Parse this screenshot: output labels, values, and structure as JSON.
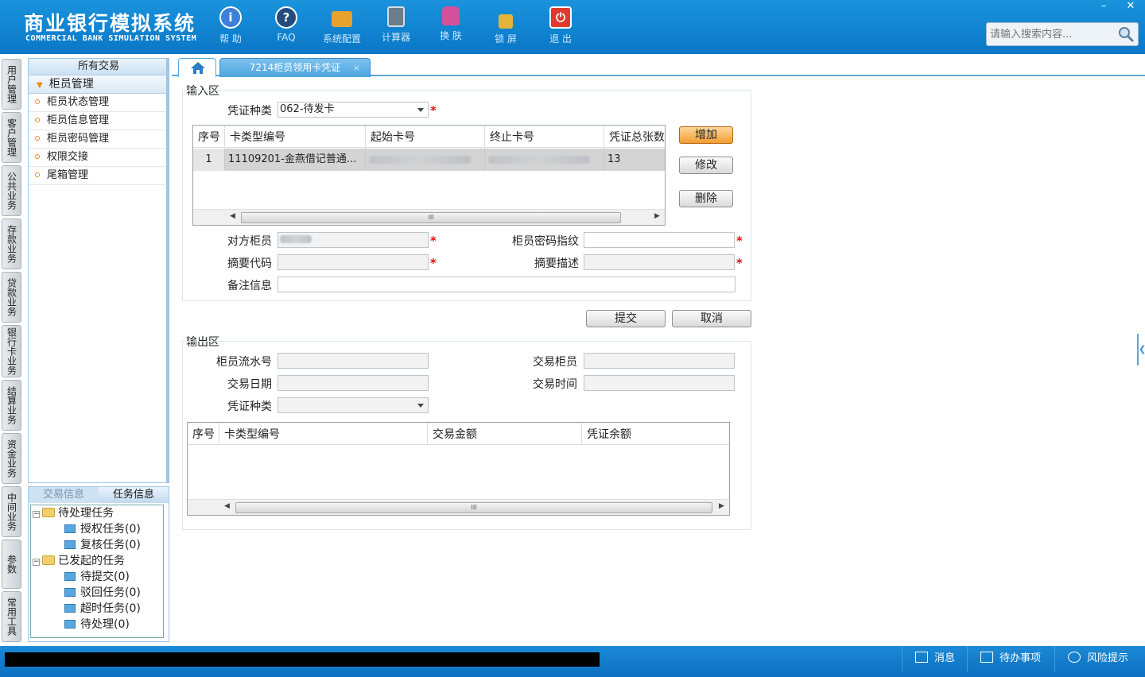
{
  "header": {
    "title_cn": "商业银行模拟系统",
    "title_en": "COMMERCIAL BANK SIMULATION SYSTEM",
    "tools": [
      {
        "label": "帮 助",
        "icon": "help-icon",
        "color": "#3c7fd8"
      },
      {
        "label": "FAQ",
        "icon": "faq-icon",
        "color": "#234c7c"
      },
      {
        "label": "系统配置",
        "icon": "toolbox-icon",
        "color": "#e7a12f"
      },
      {
        "label": "计算器",
        "icon": "calculator-icon",
        "color": "#6e7d8c"
      },
      {
        "label": "换 肤",
        "icon": "shirt-icon",
        "color": "#d5509a"
      },
      {
        "label": "锁 屏",
        "icon": "lock-icon",
        "color": "#e4b43a"
      },
      {
        "label": "退 出",
        "icon": "power-icon",
        "color": "#e03a2e"
      }
    ],
    "search_placeholder": "请输入搜索内容...",
    "win_minimize": "–",
    "win_close": "✕"
  },
  "vtabs": [
    "用户管理",
    "客户管理",
    "公共业务",
    "存款业务",
    "贷款业务",
    "银行卡业务",
    "结算业务",
    "资金业务",
    "中间业务",
    "参数",
    "常用工具"
  ],
  "nav": {
    "header": "所有交易",
    "group": "柜员管理",
    "items": [
      "柜员状态管理",
      "柜员信息管理",
      "柜员密码管理",
      "权限交接",
      "尾箱管理"
    ]
  },
  "task": {
    "tabs": [
      "交易信息",
      "任务信息"
    ],
    "pending": "待处理任务",
    "pending_items": [
      "授权任务(0)",
      "复核任务(0)"
    ],
    "initiated": "已发起的任务",
    "initiated_items": [
      "待提交(0)",
      "驳回任务(0)",
      "超时任务(0)",
      "待处理(0)"
    ]
  },
  "tabs": {
    "page_tab": "7214柜员领用卡凭证",
    "close": "×"
  },
  "input": {
    "title": "输入区",
    "voucher_type_label": "凭证种类",
    "voucher_type_value": "062-待发卡",
    "grid_headers": [
      "序号",
      "卡类型编号",
      "起始卡号",
      "终止卡号",
      "凭证总张数"
    ],
    "grid_row": {
      "seq": "1",
      "card_type": "11109201-金燕借记普通...",
      "count": "13"
    },
    "btn_add": "增加",
    "btn_edit": "修改",
    "btn_delete": "删除",
    "counter_teller_label": "对方柜员",
    "password_label": "柜员密码指纹",
    "summary_code_label": "摘要代码",
    "summary_desc_label": "摘要描述",
    "remark_label": "备注信息",
    "required": "*",
    "scroll_grip": "III"
  },
  "actions": {
    "submit": "提交",
    "cancel": "取消"
  },
  "output": {
    "title": "输出区",
    "serial_label": "柜员流水号",
    "teller_label": "交易柜员",
    "date_label": "交易日期",
    "time_label": "交易时间",
    "voucher_type_label": "凭证种类",
    "grid_headers": [
      "序号",
      "卡类型编号",
      "交易金额",
      "凭证余额"
    ]
  },
  "footer": {
    "message": "消息",
    "todo": "待办事项",
    "risk": "风险提示"
  }
}
